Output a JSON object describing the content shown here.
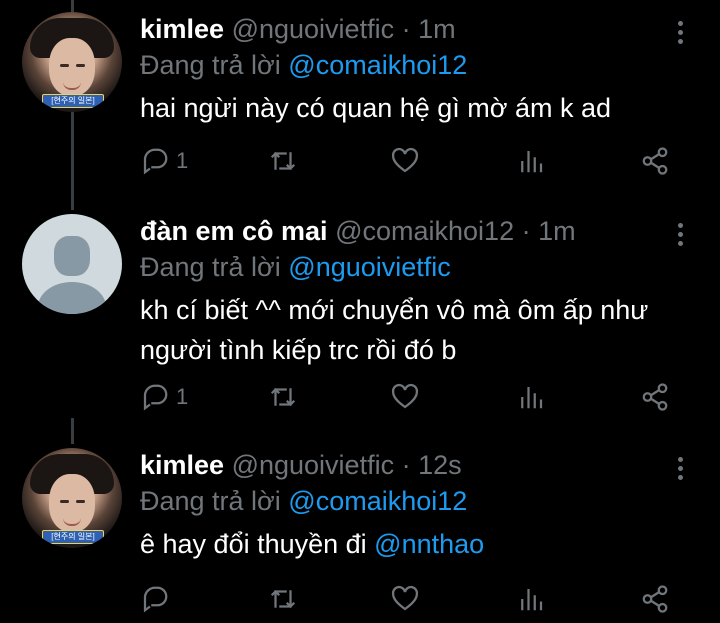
{
  "tweets": [
    {
      "name": "kimlee",
      "handle": "@nguoivietfic",
      "time": "1m",
      "replying_prefix": "Đang trả lời",
      "replying_to": "@comaikhoi12",
      "text_lines": [
        "hai ngừi này có quan hệ gì mờ ám k ad"
      ],
      "mention": "",
      "reply_count": "1",
      "avatar": "photo",
      "avatar_caption": "[현주의 일본]"
    },
    {
      "name": "đàn em cô mai",
      "handle": "@comaikhoi12",
      "time": "1m",
      "replying_prefix": "Đang trả lời",
      "replying_to": "@nguoivietfic",
      "text_lines": [
        "kh cí biết ^^ mới chuyển vô mà ôm ấp như",
        "người tình kiếp trc rồi đó b"
      ],
      "mention": "",
      "reply_count": "1",
      "avatar": "default"
    },
    {
      "name": "kimlee",
      "handle": "@nguoivietfic",
      "time": "12s",
      "replying_prefix": "Đang trả lời",
      "replying_to": "@comaikhoi12",
      "text_lines": [
        "ê hay đổi thuyền đi "
      ],
      "mention": "@nnthao",
      "reply_count": "",
      "avatar": "photo",
      "avatar_caption": "[현주의 일본]"
    }
  ],
  "icons": {
    "reply": "reply-icon",
    "retweet": "retweet-icon",
    "like": "heart-icon",
    "analytics": "analytics-icon",
    "share": "share-icon",
    "more": "more-vertical-icon"
  },
  "colors": {
    "background": "#000000",
    "muted": "#71767b",
    "accent": "#1d9bf0"
  }
}
